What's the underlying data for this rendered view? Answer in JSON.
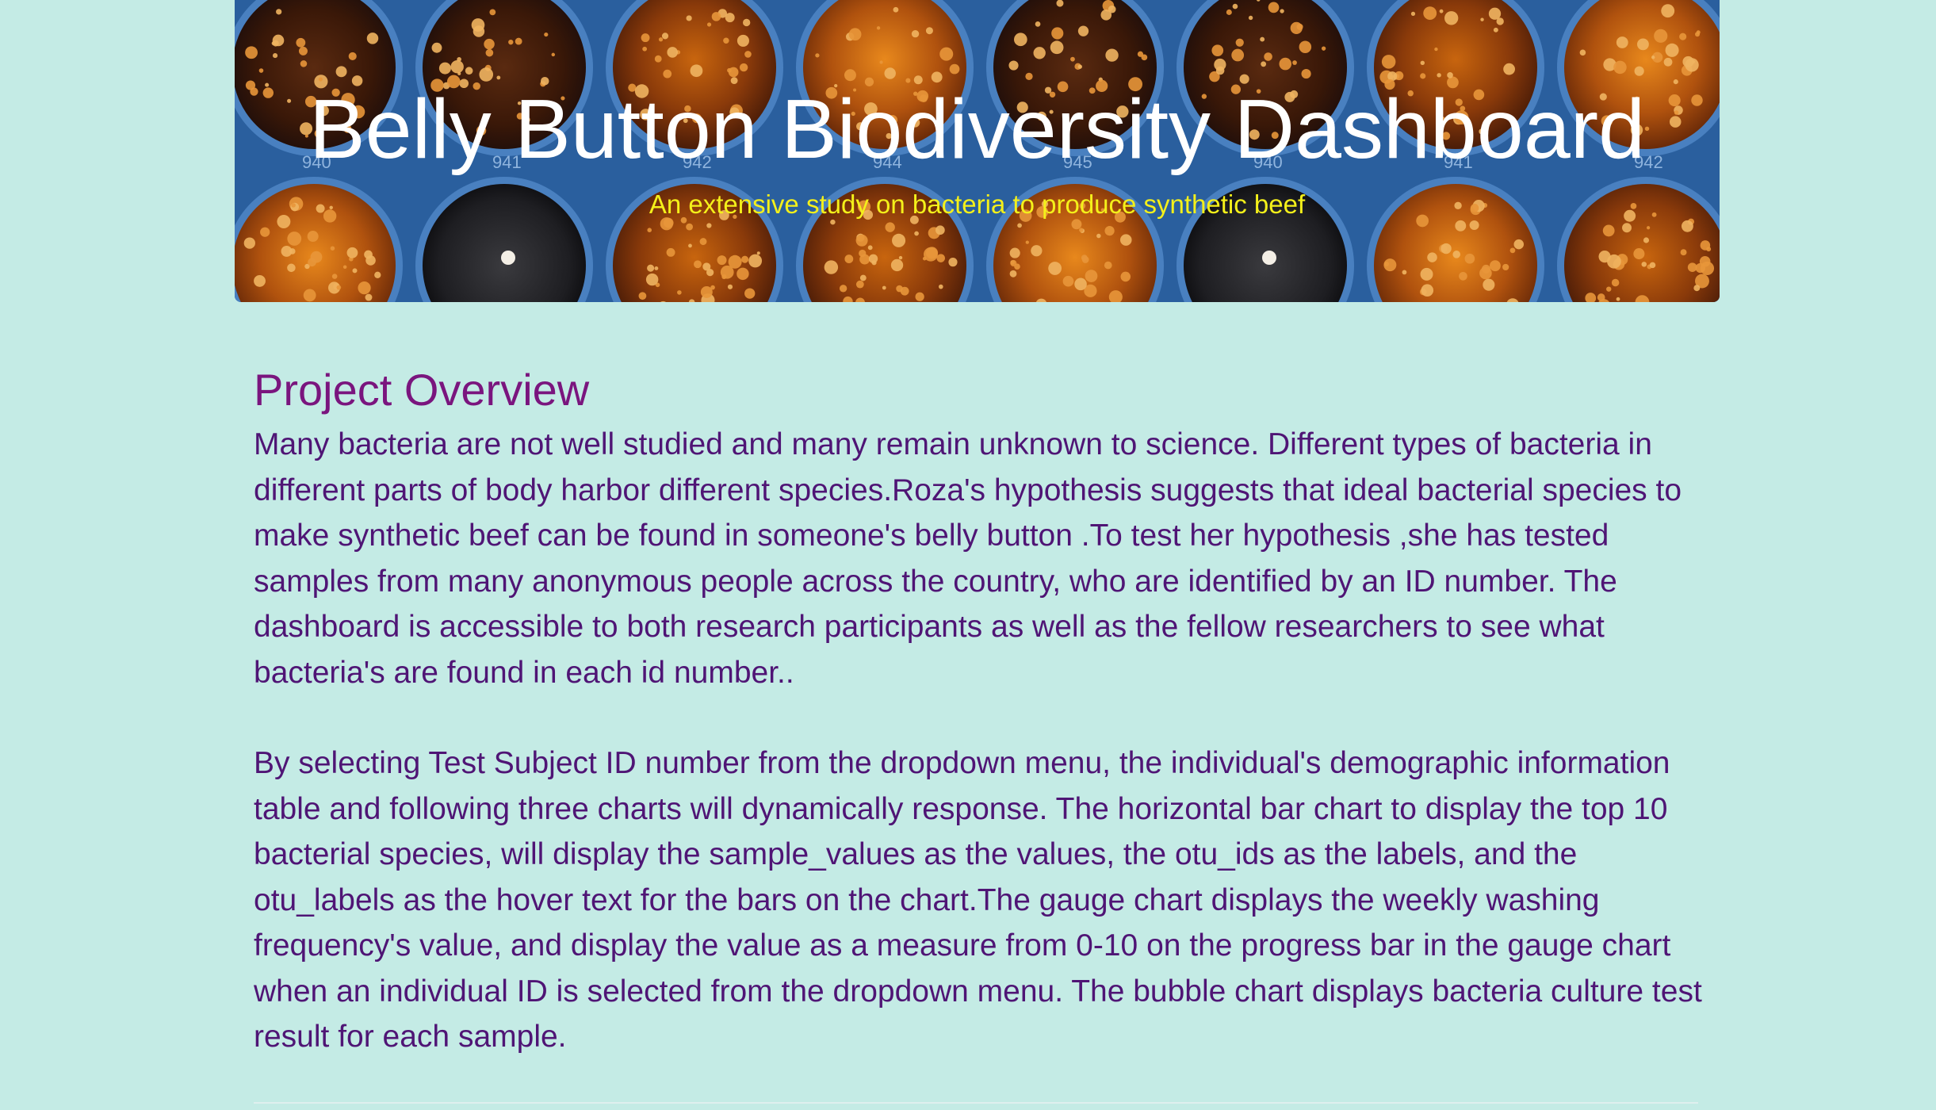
{
  "header": {
    "title": "Belly Button Biodiversity Dashboard",
    "subtitle": "An extensive study on bacteria to produce synthetic beef",
    "dish_labels": [
      "940",
      "941",
      "942",
      "944",
      "945",
      "940",
      "941",
      "942"
    ]
  },
  "overview": {
    "heading": "Project Overview",
    "paragraph_1": "Many bacteria are not well studied and many remain unknown to science. Different types of bacteria in different parts of body harbor different species.Roza's hypothesis suggests that ideal bacterial species to make synthetic beef can be found in someone's belly button .To test her hypothesis ,she has tested samples from many anonymous people across the country, who are identified by an ID number. The dashboard is accessible to both research participants as well as the fellow researchers to see what bacteria's are found in each id number..",
    "paragraph_2": "By selecting Test Subject ID number from the dropdown menu, the individual's demographic information table and following three charts will dynamically response. The horizontal bar chart to display the top 10 bacterial species, will display the sample_values as the values, the otu_ids as the labels, and the otu_labels as the hover text for the bars on the chart.The gauge chart displays the weekly washing frequency's value, and display the value as a measure from 0-10 on the progress bar in the gauge chart when an individual ID is selected from the dropdown menu. The bubble chart displays bacteria culture test result for each sample."
  },
  "colors": {
    "page_background": "#c4ebe5",
    "banner_background": "#2a5f9e",
    "title_text": "#ffffff",
    "subtitle_text": "#f4f01a",
    "heading_text": "#7a157e",
    "body_text": "#4f1575"
  }
}
